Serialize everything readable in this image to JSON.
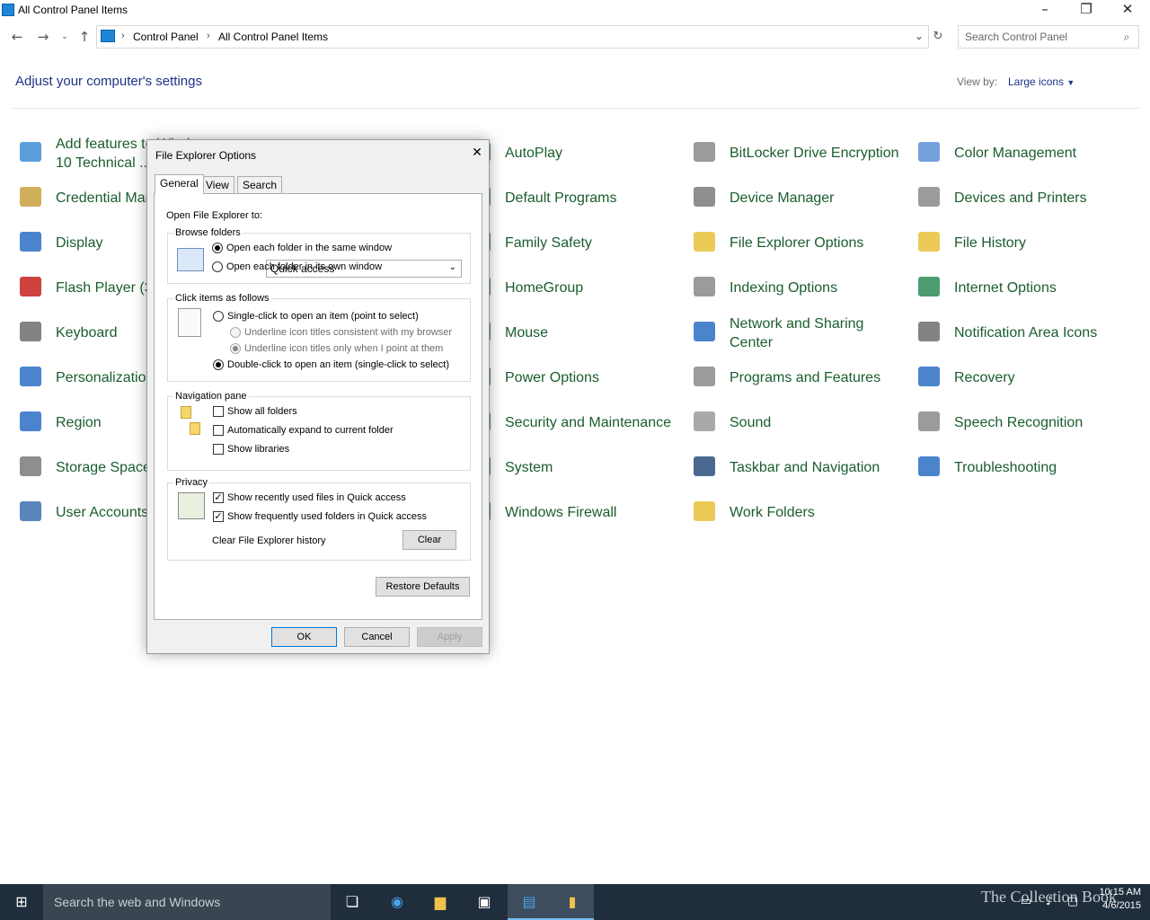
{
  "window": {
    "title": "All Control Panel Items"
  },
  "address": {
    "crumbs": [
      "Control Panel",
      "All Control Panel Items"
    ],
    "search_placeholder": "Search Control Panel"
  },
  "main": {
    "heading": "Adjust your computer's settings",
    "view_by_label": "View by:",
    "view_by_value": "Large icons"
  },
  "items": [
    {
      "label": "Add features to Windows",
      "label2": "10 Technical ...",
      "icon": "add-features-icon",
      "color": "#3d8ed6"
    },
    {
      "label": "AutoPlay",
      "icon": "autoplay-icon",
      "color": "#3b7d3b"
    },
    {
      "label": "BitLocker Drive Encryption",
      "icon": "key-icon",
      "color": "#8a8a8a"
    },
    {
      "label": "Color Management",
      "icon": "color-management-icon",
      "color": "#5b8fd6"
    },
    {
      "label": "Credential Manager",
      "icon": "credential-icon",
      "color": "#c9a13d"
    },
    {
      "label": "Default Programs",
      "icon": "default-programs-icon",
      "color": "#3b7d3b"
    },
    {
      "label": "Device Manager",
      "icon": "device-manager-icon",
      "color": "#7a7a7a"
    },
    {
      "label": "Devices and Printers",
      "icon": "printer-icon",
      "color": "#8a8a8a"
    },
    {
      "label": "Display",
      "icon": "display-icon",
      "color": "#2b6fc4"
    },
    {
      "label": "Family Safety",
      "icon": "family-icon",
      "color": "#3b7d3b"
    },
    {
      "label": "File Explorer Options",
      "icon": "folder-options-icon",
      "color": "#e7c13a"
    },
    {
      "label": "File History",
      "icon": "file-history-icon",
      "color": "#e7c13a"
    },
    {
      "label": "Flash Player (32-bit)",
      "icon": "flash-icon",
      "color": "#c4201d"
    },
    {
      "label": "HomeGroup",
      "icon": "homegroup-icon",
      "color": "#3b7d3b"
    },
    {
      "label": "Indexing Options",
      "icon": "magnifier-icon",
      "color": "#8a8a8a"
    },
    {
      "label": "Internet Options",
      "icon": "internet-icon",
      "color": "#2e8b57"
    },
    {
      "label": "Keyboard",
      "icon": "keyboard-icon",
      "color": "#6d6d6d"
    },
    {
      "label": "Mouse",
      "icon": "mouse-icon",
      "color": "#3b7d3b"
    },
    {
      "label": "Network and Sharing",
      "label2": "Center",
      "icon": "network-icon",
      "color": "#2b6fc4"
    },
    {
      "label": "Notification Area Icons",
      "icon": "notification-icon",
      "color": "#6d6d6d"
    },
    {
      "label": "Personalization",
      "icon": "personalization-icon",
      "color": "#2b6fc4"
    },
    {
      "label": "Power Options",
      "icon": "power-icon",
      "color": "#3b7d3b"
    },
    {
      "label": "Programs and Features",
      "icon": "programs-icon",
      "color": "#8a8a8a"
    },
    {
      "label": "Recovery",
      "icon": "recovery-icon",
      "color": "#2b6fc4"
    },
    {
      "label": "Region",
      "icon": "globe-clock-icon",
      "color": "#2b6fc4"
    },
    {
      "label": "Security and Maintenance",
      "icon": "flag-icon",
      "color": "#3b7d3b"
    },
    {
      "label": "Sound",
      "icon": "speaker-icon",
      "color": "#9a9a9a"
    },
    {
      "label": "Speech Recognition",
      "icon": "microphone-icon",
      "color": "#8a8a8a"
    },
    {
      "label": "Storage Spaces",
      "icon": "storage-icon",
      "color": "#7a7a7a"
    },
    {
      "label": "System",
      "icon": "system-icon",
      "color": "#3b7d3b"
    },
    {
      "label": "Taskbar and Navigation",
      "icon": "taskbar-icon",
      "color": "#2b4f7c"
    },
    {
      "label": "Troubleshooting",
      "icon": "troubleshoot-icon",
      "color": "#2b6fc4"
    },
    {
      "label": "User Accounts",
      "icon": "users-icon",
      "color": "#3d6fb0"
    },
    {
      "label": "Windows Firewall",
      "icon": "firewall-icon",
      "color": "#3b7d3b"
    },
    {
      "label": "Work Folders",
      "icon": "work-folders-icon",
      "color": "#e7c13a"
    }
  ],
  "dialog": {
    "title": "File Explorer Options",
    "tabs": [
      "General",
      "View",
      "Search"
    ],
    "open_to_label": "Open File Explorer to:",
    "open_to_value": "Quick access",
    "browse": {
      "title": "Browse folders",
      "opt1": "Open each folder in the same window",
      "opt2": "Open each folder in its own window"
    },
    "click": {
      "title": "Click items as follows",
      "opt1": "Single-click to open an item (point to select)",
      "sub1": "Underline icon titles consistent with my browser",
      "sub2": "Underline icon titles only when I point at them",
      "opt2": "Double-click to open an item (single-click to select)"
    },
    "nav": {
      "title": "Navigation pane",
      "opt1": "Show all folders",
      "opt2": "Automatically expand to current folder",
      "opt3": "Show libraries"
    },
    "privacy": {
      "title": "Privacy",
      "opt1": "Show recently used files in Quick access",
      "opt2": "Show frequently used folders in Quick access",
      "clear_label": "Clear File Explorer history",
      "clear_btn": "Clear"
    },
    "restore": "Restore Defaults",
    "ok": "OK",
    "cancel": "Cancel",
    "apply": "Apply"
  },
  "taskbar": {
    "search_placeholder": "Search the web and Windows",
    "time": "10:15 AM",
    "date": "4/6/2015",
    "watermark": "The Collection Book"
  }
}
